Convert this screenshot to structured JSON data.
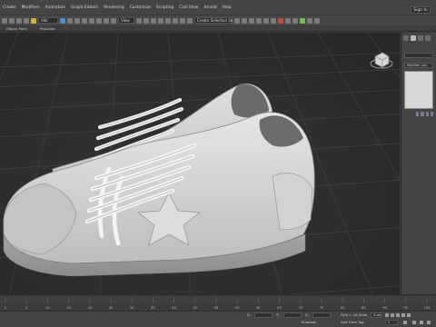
{
  "menu": {
    "items": [
      "Create",
      "Modifiers",
      "Animation",
      "Graph Editors",
      "Rendering",
      "Customize",
      "Scripting",
      "Civil View",
      "Arnold",
      "Help"
    ],
    "signin_label": "Sign In"
  },
  "toolbar": {
    "selection_filter": "Alle",
    "view_dropdown": "View",
    "named_selection": "Create Selection Se"
  },
  "ribbon": {
    "items": [
      "Object Paint",
      "Populate"
    ]
  },
  "command_panel": {
    "modifier_list_label": "Modifier List"
  },
  "timeline": {
    "ticks": [
      "0",
      "5",
      "10",
      "15",
      "20",
      "25",
      "30",
      "35",
      "40",
      "45",
      "50",
      "55",
      "60",
      "65",
      "70",
      "75",
      "80",
      "85",
      "90",
      "95",
      "100"
    ]
  },
  "status": {
    "coord_x_label": "X:",
    "coord_y_label": "Y:",
    "coord_z_label": "Z:",
    "grid_value": "Grid = 10,0mm",
    "enabled_label": "Enabled:",
    "add_time_tag": "Add Time Tag",
    "auto_key": "Auto",
    "frame_value": "0"
  }
}
